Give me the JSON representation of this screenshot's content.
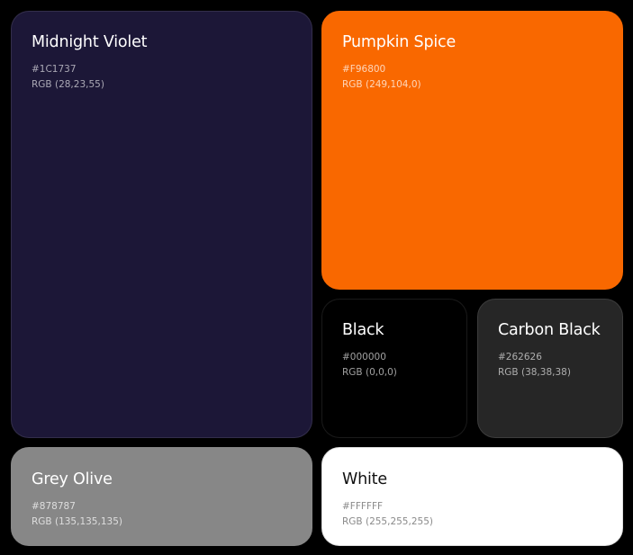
{
  "swatches": [
    {
      "id": "midnight",
      "name": "Midnight Violet",
      "hex": "#1C1737",
      "rgb": "RGB (28,23,55)",
      "color": "#1c1737"
    },
    {
      "id": "pumpkin",
      "name": "Pumpkin Spice",
      "hex": "#F96800",
      "rgb": "RGB (249,104,0)",
      "color": "#f96800"
    },
    {
      "id": "black",
      "name": "Black",
      "hex": "#000000",
      "rgb": "RGB (0,0,0)",
      "color": "#000000"
    },
    {
      "id": "carbon",
      "name": "Carbon Black",
      "hex": "#262626",
      "rgb": "RGB (38,38,38)",
      "color": "#262626"
    },
    {
      "id": "olive",
      "name": "Grey Olive",
      "hex": "#878787",
      "rgb": "RGB (135,135,135)",
      "color": "#878787"
    },
    {
      "id": "white",
      "name": "White",
      "hex": "#FFFFFF",
      "rgb": "RGB (255,255,255)",
      "color": "#ffffff"
    }
  ]
}
